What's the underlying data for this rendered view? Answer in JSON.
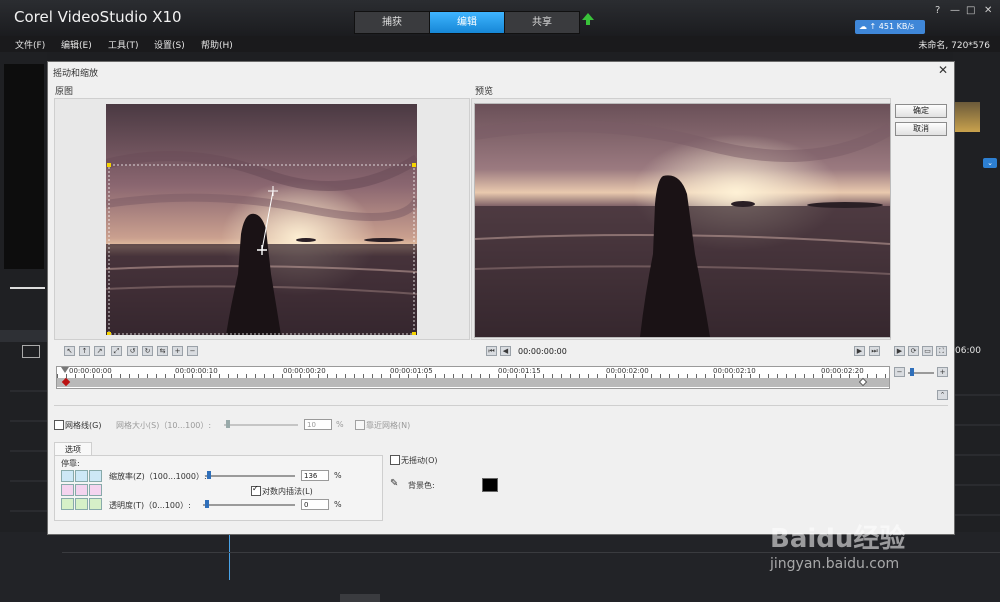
{
  "app": {
    "title": "Corel VideoStudio X10",
    "tabs": [
      "捕获",
      "编辑",
      "共享"
    ],
    "active_tab": "编辑",
    "net_speed": "451 KB/s",
    "menu": [
      "文件(F)",
      "编辑(E)",
      "工具(T)",
      "设置(S)",
      "帮助(H)"
    ],
    "project_info": "未命名, 720*576"
  },
  "dialog": {
    "title": "摇动和缩放",
    "original_label": "原图",
    "preview_label": "预览",
    "ok_label": "确定",
    "cancel_label": "取消",
    "preview_timecode": "00:00:00:00",
    "timeline_codes": [
      "00:00:00:00",
      "00:00:00:10",
      "00:00:00:20",
      "00:00:01:05",
      "00:00:01:15",
      "00:00:02:00",
      "00:00:02:10",
      "00:00:02:20"
    ],
    "gridlines_label": "网格线(G)",
    "grid_size_label": "网格大小(S)（10...100）:",
    "grid_size_value": "10",
    "grid_size_unit": "%",
    "snap_label": "靠近网格(N)",
    "options_tab": "选项",
    "stop_label": "停靠:",
    "zoom_label": "缩放率(Z)（100...1000）:",
    "zoom_value": "136",
    "zoom_unit": "%",
    "interp_label": "对数内插法(L)",
    "opacity_label": "透明度(T)（0...100）:",
    "opacity_value": "0",
    "opacity_unit": "%",
    "no_shake_label": "无摇动(O)",
    "bg_color_label": "背景色:",
    "bg_color": "#000000"
  },
  "background": {
    "right_time": "06:00"
  },
  "watermark": {
    "brand": "Baidu经验",
    "url": "jingyan.baidu.com"
  }
}
